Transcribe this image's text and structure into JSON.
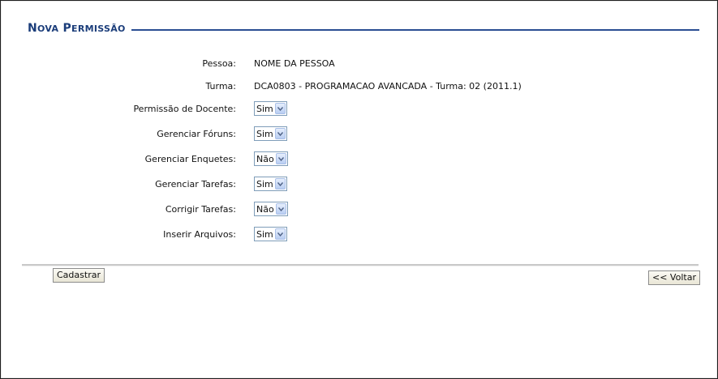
{
  "page": {
    "title_first": "N",
    "title_rest1": "OVA",
    "title_second": " P",
    "title_rest2": "ERMISSÃO"
  },
  "fields": {
    "pessoa": {
      "label": "Pessoa:",
      "value": "NOME DA PESSOA"
    },
    "turma": {
      "label": "Turma:",
      "value": "DCA0803 - PROGRAMACAO AVANCADA - Turma: 02 (2011.1)"
    },
    "permissao_docente": {
      "label": "Permissão de Docente:",
      "value": "Sim"
    },
    "gerenciar_foruns": {
      "label": "Gerenciar Fóruns:",
      "value": "Sim"
    },
    "gerenciar_enquetes": {
      "label": "Gerenciar Enquetes:",
      "value": "Não"
    },
    "gerenciar_tarefas": {
      "label": "Gerenciar Tarefas:",
      "value": "Sim"
    },
    "corrigir_tarefas": {
      "label": "Corrigir Tarefas:",
      "value": "Não"
    },
    "inserir_arquivos": {
      "label": "Inserir Arquivos:",
      "value": "Sim"
    }
  },
  "buttons": {
    "cadastrar": "Cadastrar",
    "voltar": "<< Voltar"
  },
  "colors": {
    "title": "#1b3d7a",
    "title_line": "#2a4e93",
    "select_border": "#7f9db9"
  },
  "icons": {
    "select_arrow": "chevron-down-icon"
  }
}
